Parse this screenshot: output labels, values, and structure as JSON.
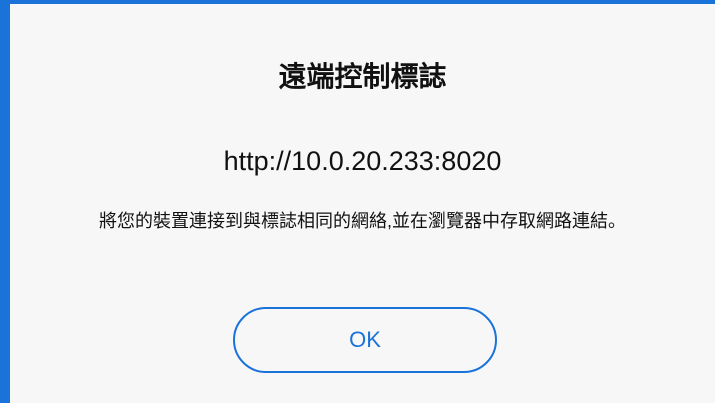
{
  "dialog": {
    "title": "遠端控制標誌",
    "url": "http://10.0.20.233:8020",
    "message": "將您的裝置連接到與標誌相同的網絡,並在瀏覽器中存取網路連結。",
    "ok_label": "OK"
  },
  "colors": {
    "accent": "#1a73d9",
    "background": "#f7f7f7",
    "text": "#111111"
  }
}
